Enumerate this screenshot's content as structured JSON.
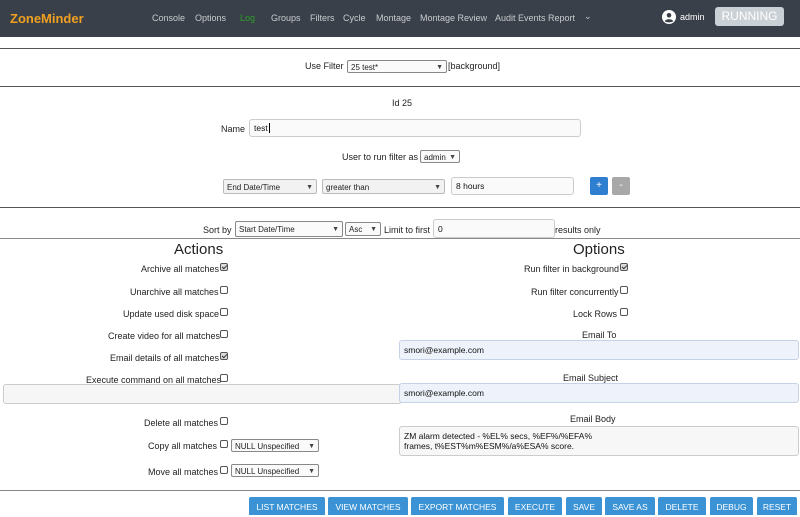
{
  "nav": {
    "brand": "ZoneMinder",
    "items": [
      "Console",
      "Options",
      "Log",
      "Groups",
      "Filters",
      "Cycle",
      "Montage",
      "Montage Review",
      "Audit Events Report"
    ],
    "active_item": "Log",
    "more": "⌄",
    "user": "admin",
    "status": "RUNNING"
  },
  "filter_select": {
    "label": "Use Filter",
    "value": "25 test*",
    "suffix": "[background]"
  },
  "id_text": "Id 25",
  "name": {
    "label": "Name",
    "value": "test"
  },
  "run_as": {
    "label": "User to run filter as",
    "value": "admin"
  },
  "term": {
    "attribute": "End Date/Time",
    "operator": "greater than",
    "value": "8 hours",
    "add": "+",
    "remove": "-"
  },
  "sort": {
    "label": "Sort by",
    "field": "Start Date/Time",
    "order": "Asc",
    "limit_label": "Limit to first",
    "limit_value": "0",
    "limit_suffix": "results only"
  },
  "actions": {
    "heading": "Actions",
    "archive": "Archive all matches",
    "unarchive": "Unarchive all matches",
    "update_disk": "Update used disk space",
    "create_video": "Create video for all matches",
    "email_details": "Email details of all matches",
    "execute_cmd": "Execute command on all matches",
    "delete": "Delete all matches",
    "copy": "Copy all matches",
    "move": "Move all matches",
    "copy_storage": "NULL Unspecified",
    "move_storage": "NULL Unspecified"
  },
  "options": {
    "heading": "Options",
    "background": "Run filter in background",
    "concurrent": "Run filter concurrently",
    "lock_rows": "Lock Rows",
    "email_to_label": "Email To",
    "email_to": "smori@example.com",
    "email_subject_label": "Email Subject",
    "email_subject": "smori@example.com",
    "email_body_label": "Email Body",
    "email_body_1": "ZM alarm detected - %EL% secs, %EF%/%EFA%",
    "email_body_2": "frames, t%EST%m%ESM%/a%ESA% score."
  },
  "buttons": {
    "list": "LIST MATCHES",
    "view": "VIEW MATCHES",
    "export": "EXPORT MATCHES",
    "execute": "EXECUTE",
    "save": "SAVE",
    "save_as": "SAVE AS",
    "delete": "DELETE",
    "debug": "DEBUG",
    "reset": "RESET"
  },
  "colors": {
    "navbar": "#3a4049",
    "brand": "#f0a020",
    "active": "#2ca02c",
    "button": "#3b93d6"
  }
}
